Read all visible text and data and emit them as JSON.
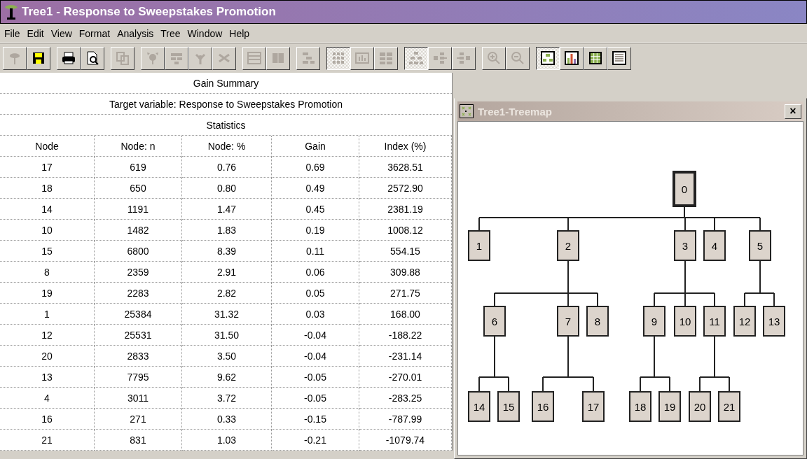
{
  "window": {
    "title": "Tree1 - Response to Sweepstakes Promotion"
  },
  "menu": [
    "File",
    "Edit",
    "View",
    "Format",
    "Analysis",
    "Tree",
    "Window",
    "Help"
  ],
  "toolbar": [
    [
      {
        "kind": "new-tree",
        "disabled": true,
        "pressed": false
      },
      {
        "kind": "save",
        "disabled": false,
        "pressed": false
      }
    ],
    [
      {
        "kind": "print",
        "disabled": false,
        "pressed": false
      },
      {
        "kind": "preview",
        "disabled": false,
        "pressed": false
      }
    ],
    [
      {
        "kind": "copy",
        "disabled": true,
        "pressed": false
      }
    ],
    [
      {
        "kind": "grow",
        "disabled": true,
        "pressed": false
      },
      {
        "kind": "grow-tree",
        "disabled": true,
        "pressed": false
      },
      {
        "kind": "grow-branch",
        "disabled": true,
        "pressed": false
      },
      {
        "kind": "prune",
        "disabled": true,
        "pressed": false
      }
    ],
    [
      {
        "kind": "rules",
        "disabled": true,
        "pressed": false
      },
      {
        "kind": "gains",
        "disabled": true,
        "pressed": false
      }
    ],
    [
      {
        "kind": "split",
        "disabled": true,
        "pressed": false
      }
    ],
    [
      {
        "kind": "grid-view",
        "disabled": true,
        "pressed": true
      },
      {
        "kind": "bar-view",
        "disabled": true,
        "pressed": false
      },
      {
        "kind": "table-view",
        "disabled": true,
        "pressed": false
      }
    ],
    [
      {
        "kind": "top-down",
        "disabled": true,
        "pressed": true
      },
      {
        "kind": "left-right",
        "disabled": true,
        "pressed": false
      },
      {
        "kind": "right-left",
        "disabled": true,
        "pressed": false
      }
    ],
    [
      {
        "kind": "zoom-in",
        "disabled": true,
        "pressed": false
      },
      {
        "kind": "zoom-out",
        "disabled": true,
        "pressed": false
      }
    ],
    [
      {
        "kind": "treemap",
        "disabled": false,
        "pressed": true
      },
      {
        "kind": "chart",
        "disabled": false,
        "pressed": false
      },
      {
        "kind": "grid",
        "disabled": false,
        "pressed": false
      },
      {
        "kind": "table",
        "disabled": false,
        "pressed": false
      }
    ]
  ],
  "gain_table": {
    "title": "Gain Summary",
    "subtitle": "Target variable: Response to Sweepstakes Promotion",
    "section": "Statistics",
    "columns": [
      "Node",
      "Node: n",
      "Node: %",
      "Gain",
      "Index (%)"
    ],
    "rows": [
      [
        "17",
        "619",
        "0.76",
        "0.69",
        "3628.51"
      ],
      [
        "18",
        "650",
        "0.80",
        "0.49",
        "2572.90"
      ],
      [
        "14",
        "1191",
        "1.47",
        "0.45",
        "2381.19"
      ],
      [
        "10",
        "1482",
        "1.83",
        "0.19",
        "1008.12"
      ],
      [
        "15",
        "6800",
        "8.39",
        "0.11",
        "554.15"
      ],
      [
        "8",
        "2359",
        "2.91",
        "0.06",
        "309.88"
      ],
      [
        "19",
        "2283",
        "2.82",
        "0.05",
        "271.75"
      ],
      [
        "1",
        "25384",
        "31.32",
        "0.03",
        "168.00"
      ],
      [
        "12",
        "25531",
        "31.50",
        "-0.04",
        "-188.22"
      ],
      [
        "20",
        "2833",
        "3.50",
        "-0.04",
        "-231.14"
      ],
      [
        "13",
        "7795",
        "9.62",
        "-0.05",
        "-270.01"
      ],
      [
        "4",
        "3011",
        "3.72",
        "-0.05",
        "-283.25"
      ],
      [
        "16",
        "271",
        "0.33",
        "-0.15",
        "-787.99"
      ],
      [
        "21",
        "831",
        "1.03",
        "-0.21",
        "-1079.74"
      ]
    ]
  },
  "treemap": {
    "title": "Tree1-Treemap",
    "close": "×",
    "root": {
      "label": "0",
      "selected": true,
      "children": [
        {
          "label": "1",
          "selected": false
        },
        {
          "label": "2",
          "selected": false,
          "children": [
            {
              "label": "6",
              "selected": false,
              "children": [
                {
                  "label": "14",
                  "selected": false
                },
                {
                  "label": "15",
                  "selected": false
                }
              ]
            },
            {
              "label": "7",
              "selected": false,
              "children": [
                {
                  "label": "16",
                  "selected": false
                },
                {
                  "label": "17",
                  "selected": false
                }
              ]
            },
            {
              "label": "8",
              "selected": false
            }
          ]
        },
        {
          "label": "3",
          "selected": false,
          "children": [
            {
              "label": "9",
              "selected": false,
              "children": [
                {
                  "label": "18",
                  "selected": false
                },
                {
                  "label": "19",
                  "selected": false
                }
              ]
            },
            {
              "label": "10",
              "selected": false
            },
            {
              "label": "11",
              "selected": false,
              "children": [
                {
                  "label": "20",
                  "selected": false
                },
                {
                  "label": "21",
                  "selected": false
                }
              ]
            }
          ]
        },
        {
          "label": "4",
          "selected": false
        },
        {
          "label": "5",
          "selected": false,
          "children": [
            {
              "label": "12",
              "selected": false
            },
            {
              "label": "13",
              "selected": false
            }
          ]
        }
      ]
    }
  }
}
